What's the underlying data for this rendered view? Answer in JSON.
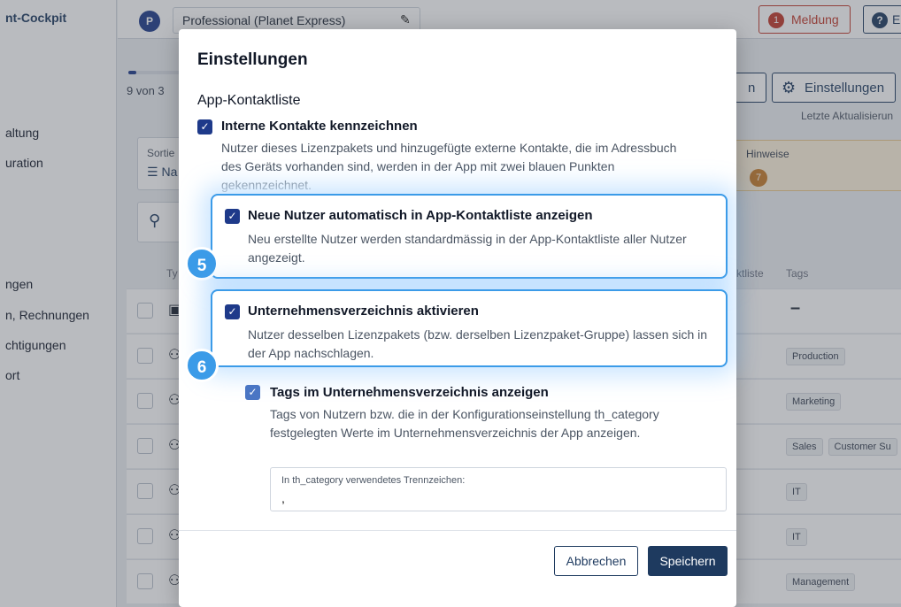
{
  "sidebar": {
    "brand": "nt-Cockpit",
    "items": [
      {
        "label": "altung"
      },
      {
        "label": "uration"
      },
      {
        "label": "ngen"
      },
      {
        "label": "n, Rechnungen"
      },
      {
        "label": "chtigungen"
      },
      {
        "label": "ort"
      }
    ]
  },
  "header": {
    "avatar_letter": "P",
    "product": "Professional (Planet Express)",
    "meldung_count": "1",
    "meldung_label": "Meldung",
    "help_glyph": "?",
    "help_label": "E"
  },
  "page": {
    "progress_text": "9 von 3",
    "progress_fraction": 0.15,
    "n_button": "n",
    "settings_button": "Einstellungen",
    "last_update": "Letzte Aktualisierun",
    "sort_label": "Sortie",
    "sort_value": "Na",
    "hinweise_label": "Hinweise",
    "hinweise_count": "7",
    "col_type": "Ty",
    "col_kontaktliste": "ktliste",
    "col_tags": "Tags",
    "rows": [
      {
        "tags": [],
        "dash": "–"
      },
      {
        "tags": [
          "Production"
        ]
      },
      {
        "tags": [
          "Marketing"
        ]
      },
      {
        "tags": [
          "Sales",
          "Customer Su"
        ]
      },
      {
        "tags": [
          "IT"
        ]
      },
      {
        "tags": [
          "IT"
        ]
      },
      {
        "tags": [
          "Management"
        ]
      }
    ]
  },
  "dialog": {
    "title": "Einstellungen",
    "section": "App-Kontaktliste",
    "opt1": {
      "label": "Interne Kontakte kennzeichnen",
      "desc": "Nutzer dieses Lizenzpakets und hinzugefügte externe Kontakte, die im Adressbuch des Geräts vorhanden sind, werden in der App mit zwei blauen Punkten gekennzeichnet."
    },
    "opt2": {
      "label": "Neue Nutzer automatisch in App-Kontaktliste anzeigen",
      "desc": "Neu erstellte Nutzer werden standardmässig in der App-Kontaktliste aller Nutzer angezeigt.",
      "step": "5"
    },
    "opt3": {
      "label": "Unternehmensverzeichnis aktivieren",
      "desc": "Nutzer desselben Lizenzpakets (bzw. derselben Lizenzpaket-Gruppe) lassen sich in der App nachschlagen.",
      "step": "6"
    },
    "opt4": {
      "label": "Tags im Unternehmensverzeichnis anzeigen",
      "desc": "Tags von Nutzern bzw. die in der Konfigurationseinstellung th_category festgelegten Werte im Unternehmensverzeichnis der App anzeigen."
    },
    "separator_field": {
      "label": "In th_category verwendetes Trennzeichen:",
      "value": ","
    },
    "cancel": "Abbrechen",
    "save": "Speichern"
  },
  "colors": {
    "primary": "#1e3a5f",
    "checkbox": "#1e3a8a",
    "highlight": "#3b9be8",
    "alert": "#c0392b"
  }
}
